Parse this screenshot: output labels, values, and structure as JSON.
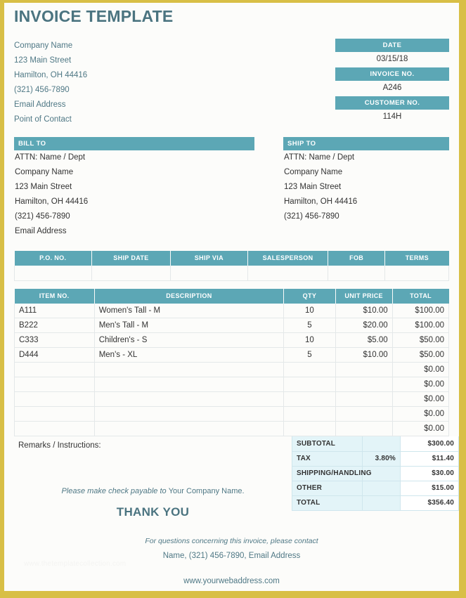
{
  "theme": {
    "frame_gold": "#d8bf46",
    "accent_teal": "#5ca7b5",
    "heading_slate": "#4b7480",
    "totals_bg": "#e3f4f8"
  },
  "title": "INVOICE TEMPLATE",
  "company": {
    "lines": [
      "Company Name",
      "123 Main Street",
      "Hamilton, OH 44416",
      "(321) 456-7890",
      "Email Address",
      "Point of Contact"
    ]
  },
  "meta": [
    {
      "label": "DATE",
      "value": "03/15/18"
    },
    {
      "label": "INVOICE NO.",
      "value": "A246"
    },
    {
      "label": "CUSTOMER NO.",
      "value": "114H"
    }
  ],
  "bill_to": {
    "heading": "BILL TO",
    "lines": [
      "ATTN: Name / Dept",
      "Company Name",
      "123 Main Street",
      "Hamilton, OH 44416",
      "(321) 456-7890",
      "Email Address"
    ]
  },
  "ship_to": {
    "heading": "SHIP TO",
    "lines": [
      "ATTN: Name / Dept",
      "Company Name",
      "123 Main Street",
      "Hamilton, OH 44416",
      "(321) 456-7890"
    ]
  },
  "shipping_table": {
    "headers": [
      "P.O. NO.",
      "SHIP DATE",
      "SHIP VIA",
      "SALESPERSON",
      "FOB",
      "TERMS"
    ],
    "row": [
      "",
      "",
      "",
      "",
      "",
      ""
    ]
  },
  "items_table": {
    "headers": [
      "ITEM NO.",
      "DESCRIPTION",
      "QTY",
      "UNIT PRICE",
      "TOTAL"
    ],
    "rows": [
      {
        "item": "A111",
        "description": "Women's Tall - M",
        "qty": "10",
        "unit_price": "$10.00",
        "total": "$100.00"
      },
      {
        "item": "B222",
        "description": "Men's Tall - M",
        "qty": "5",
        "unit_price": "$20.00",
        "total": "$100.00"
      },
      {
        "item": "C333",
        "description": "Children's - S",
        "qty": "10",
        "unit_price": "$5.00",
        "total": "$50.00"
      },
      {
        "item": "D444",
        "description": "Men's - XL",
        "qty": "5",
        "unit_price": "$10.00",
        "total": "$50.00"
      },
      {
        "item": "",
        "description": "",
        "qty": "",
        "unit_price": "",
        "total": "$0.00"
      },
      {
        "item": "",
        "description": "",
        "qty": "",
        "unit_price": "",
        "total": "$0.00"
      },
      {
        "item": "",
        "description": "",
        "qty": "",
        "unit_price": "",
        "total": "$0.00"
      },
      {
        "item": "",
        "description": "",
        "qty": "",
        "unit_price": "",
        "total": "$0.00"
      },
      {
        "item": "",
        "description": "",
        "qty": "",
        "unit_price": "",
        "total": "$0.00"
      }
    ]
  },
  "remarks": {
    "label": "Remarks / Instructions:",
    "value": "",
    "payable_italic": "Please make check payable to ",
    "payable_rest": "Your Company Name.",
    "thank_you": "THANK YOU"
  },
  "totals": [
    {
      "label": "SUBTOTAL",
      "rate": "",
      "value": "$300.00",
      "bold": false
    },
    {
      "label": "TAX",
      "rate": "3.80%",
      "value": "$11.40",
      "bold": false
    },
    {
      "label": "SHIPPING/HANDLING",
      "rate": "",
      "value": "$30.00",
      "bold": false
    },
    {
      "label": "OTHER",
      "rate": "",
      "value": "$15.00",
      "bold": false
    },
    {
      "label": "TOTAL",
      "rate": "",
      "value": "$356.40",
      "bold": true
    }
  ],
  "footer": {
    "questions": "For questions concerning this invoice, please contact",
    "contact": "Name, (321) 456-7890, Email Address",
    "website": "www.yourwebaddress.com",
    "watermark": "www.thetemplatecollection.com"
  }
}
